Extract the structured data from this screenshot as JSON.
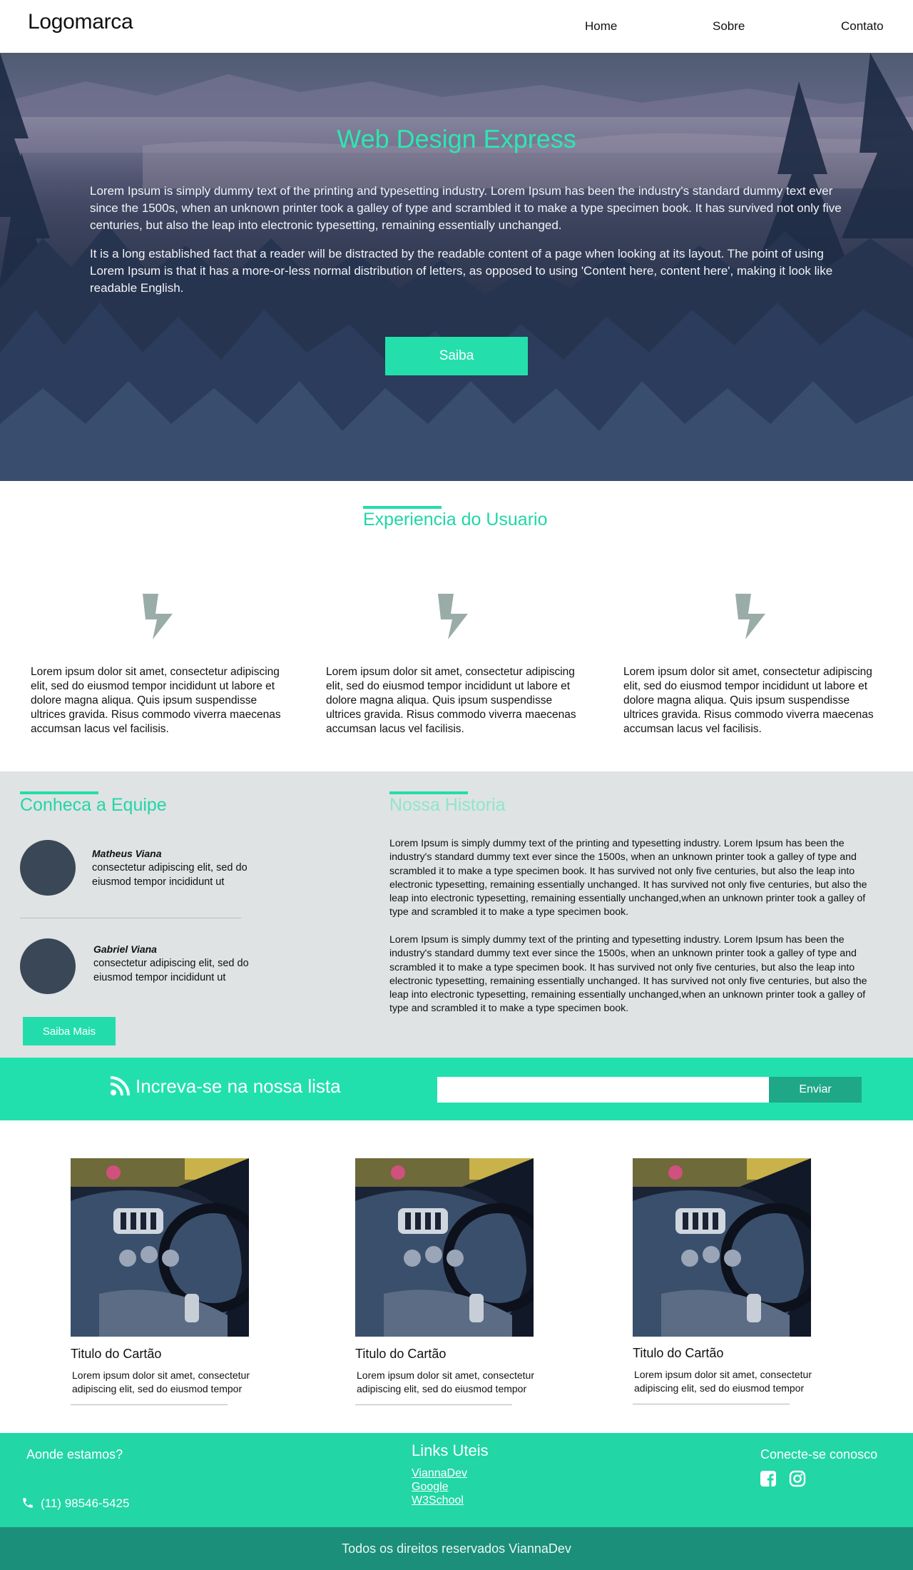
{
  "nav": {
    "logo": "Logomarca",
    "links": [
      "Home",
      "Sobre",
      "Contato"
    ]
  },
  "hero": {
    "title": "Web Design Express",
    "paragraphs": [
      "Lorem Ipsum is simply dummy text of the printing and typesetting industry. Lorem Ipsum has been the industry's standard dummy text ever since the 1500s, when an unknown printer took a galley of type and scrambled it to make a type specimen book. It has survived not only five centuries, but also the leap into electronic typesetting, remaining essentially unchanged.",
      "It is a long established fact that a reader will be distracted by the readable content of a page when looking at its layout. The point of using Lorem Ipsum is that it has a more-or-less normal distribution of letters, as opposed to using 'Content here, content here', making it look like readable English."
    ],
    "button": "Saiba"
  },
  "experience": {
    "title": "Experiencia do Usuario",
    "features": [
      {
        "icon": "lightning-bolt-icon",
        "text": "Lorem ipsum dolor sit amet, consectetur adipiscing elit, sed do eiusmod tempor incididunt ut labore et dolore magna aliqua. Quis ipsum suspendisse ultrices gravida. Risus commodo viverra maecenas accumsan lacus vel facilisis."
      },
      {
        "icon": "lightning-bolt-icon",
        "text": "Lorem ipsum dolor sit amet, consectetur adipiscing elit, sed do eiusmod tempor incididunt ut labore et dolore magna aliqua. Quis ipsum suspendisse ultrices gravida. Risus commodo viverra maecenas accumsan lacus vel facilisis."
      },
      {
        "icon": "lightning-bolt-icon",
        "text": "Lorem ipsum dolor sit amet, consectetur adipiscing elit, sed do eiusmod tempor incididunt ut labore et dolore magna aliqua. Quis ipsum suspendisse ultrices gravida. Risus commodo viverra maecenas accumsan lacus vel facilisis."
      }
    ]
  },
  "team": {
    "title": "Conheca a Equipe",
    "members": [
      {
        "name": "Matheus Viana",
        "description": "consectetur adipiscing elit, sed do eiusmod tempor incididunt ut"
      },
      {
        "name": "Gabriel Viana",
        "description": "consectetur adipiscing elit, sed do eiusmod tempor incididunt ut"
      }
    ],
    "button": "Saiba Mais"
  },
  "history": {
    "title": "Nossa Historia",
    "paragraphs": [
      "Lorem Ipsum is simply dummy text of the printing and typesetting industry. Lorem Ipsum has been the industry's standard dummy text ever since the 1500s, when an unknown printer took a galley of type and scrambled it to make a type specimen book. It has survived not only five centuries, but also the leap into electronic typesetting, remaining essentially unchanged. It has survived not only five centuries, but also the leap into electronic typesetting, remaining essentially unchanged,when an unknown printer took a galley of type and scrambled it to make a type specimen book.",
      "Lorem Ipsum is simply dummy text of the printing and typesetting industry. Lorem Ipsum has been the industry's standard dummy text ever since the 1500s, when an unknown printer took a galley of type and scrambled it to make a type specimen book. It has survived not only five centuries, but also the leap into electronic typesetting, remaining essentially unchanged. It has survived not only five centuries, but also the leap into electronic typesetting, remaining essentially unchanged,when an unknown printer took a galley of type and scrambled it to make a type specimen book."
    ]
  },
  "newsletter": {
    "icon": "rss-icon",
    "title": "Increva-se na nossa lista",
    "input_value": "",
    "button": "Enviar"
  },
  "cards": [
    {
      "title": "Titulo do Cartão",
      "text": "Lorem ipsum dolor sit amet, consectetur adipiscing elit, sed do eiusmod tempor"
    },
    {
      "title": "Titulo do Cartão",
      "text": "Lorem ipsum dolor sit amet, consectetur adipiscing elit, sed do eiusmod tempor"
    },
    {
      "title": "Titulo do Cartão",
      "text": "Lorem ipsum dolor sit amet, consectetur adipiscing elit, sed do eiusmod tempor"
    }
  ],
  "footer": {
    "location_title": "Aonde estamos?",
    "phone": "(11) 98546-5425",
    "links_title": "Links Uteis",
    "links": [
      "ViannaDev",
      "Google",
      "W3School"
    ],
    "social_title": "Conecte-se conosco",
    "social_icons": [
      "facebook-icon",
      "instagram-icon"
    ],
    "copyright": "Todos os direitos reservados ViannaDev"
  },
  "colors": {
    "accent": "#22ddab",
    "accent_dark": "#1ea888",
    "footer_bottom": "#1b8f7a",
    "gray_section": "#dfe3e3",
    "avatar": "#3a4757",
    "icon_gray": "#9aaca8"
  }
}
